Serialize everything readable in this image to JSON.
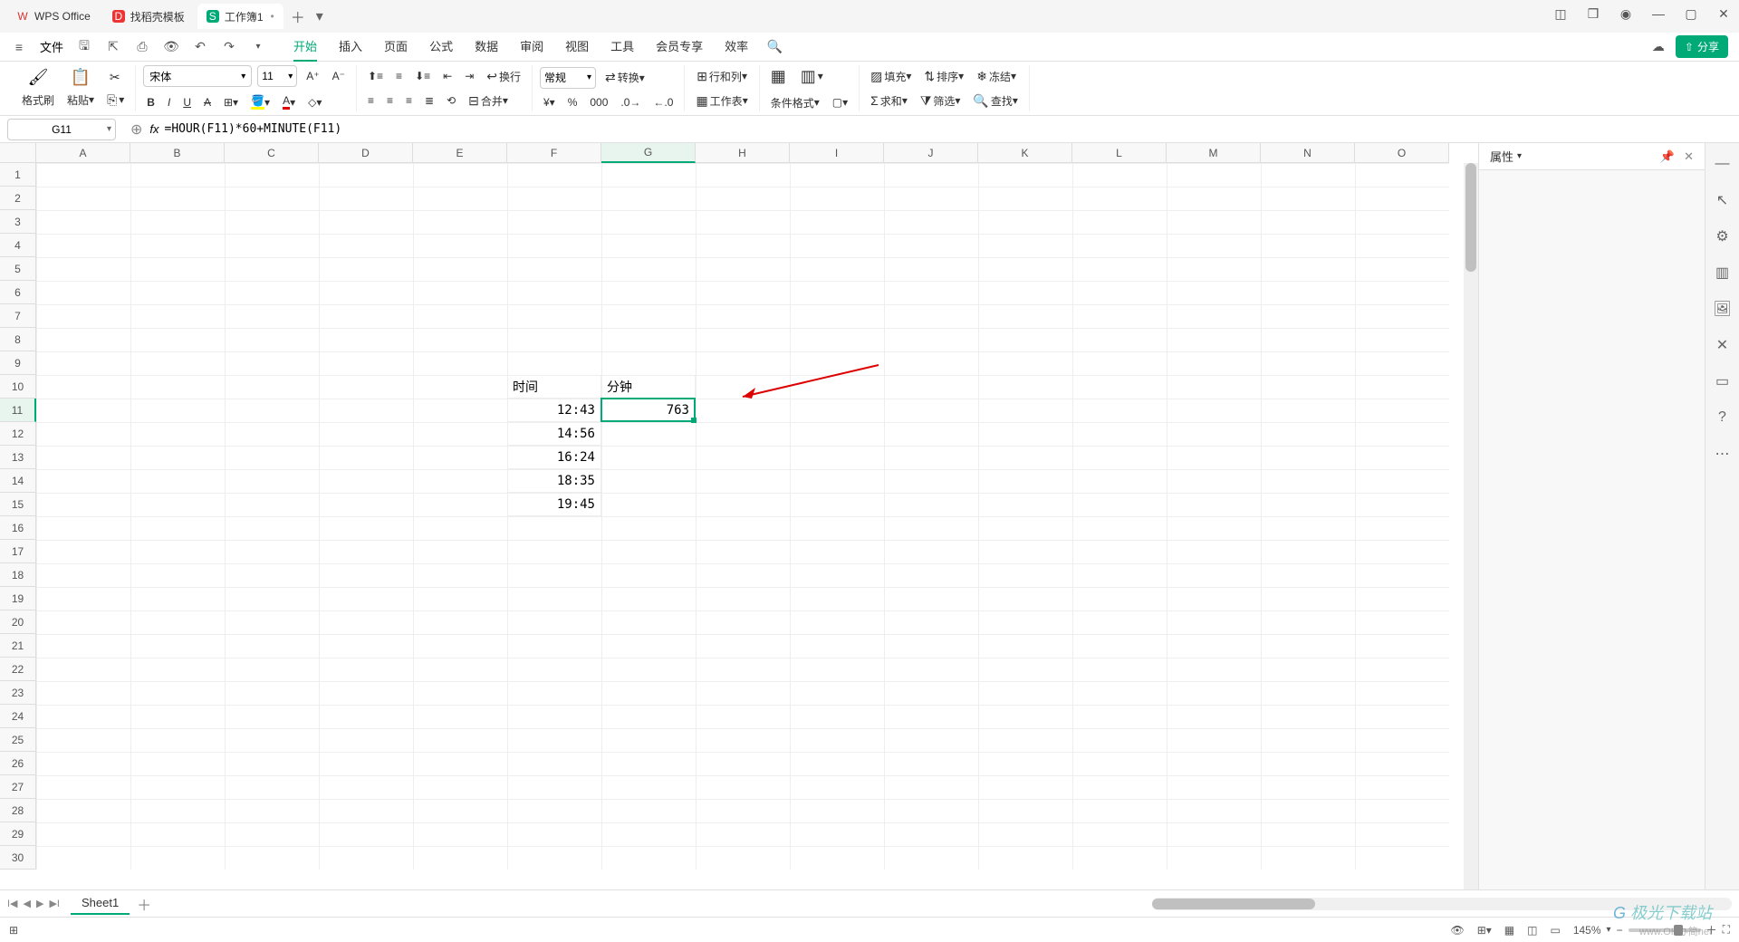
{
  "tabs": {
    "wps": "WPS Office",
    "template": "找稻壳模板",
    "workbook": "工作簿1"
  },
  "file_menu": "文件",
  "menus": [
    "开始",
    "插入",
    "页面",
    "公式",
    "数据",
    "审阅",
    "视图",
    "工具",
    "会员专享",
    "效率"
  ],
  "ribbon": {
    "format_painter": "格式刷",
    "paste": "粘贴",
    "font": "宋体",
    "size": "11",
    "wrap": "换行",
    "merge": "合并",
    "numfmt": "常规",
    "convert": "转换",
    "rowcol": "行和列",
    "worksheet": "工作表",
    "condfmt": "条件格式",
    "fill": "填充",
    "sort": "排序",
    "freeze": "冻结",
    "sum": "求和",
    "filter": "筛选",
    "find": "查找"
  },
  "share": "分享",
  "namebox": "G11",
  "formula": "=HOUR(F11)*60+MINUTE(F11)",
  "cols": [
    "A",
    "B",
    "C",
    "D",
    "E",
    "F",
    "G",
    "H",
    "I",
    "J",
    "K",
    "L",
    "M",
    "N",
    "O"
  ],
  "rowcount": 30,
  "data": {
    "F10": "时间",
    "G10": "分钟",
    "F11": "12:43",
    "G11": "763",
    "F12": "14:56",
    "F13": "16:24",
    "F14": "18:35",
    "F15": "19:45"
  },
  "active": {
    "col": 6,
    "row": 11
  },
  "side": {
    "title": "属性"
  },
  "sheet_tab": "Sheet1",
  "zoom": "145%",
  "watermark": "极光下载站",
  "watermark2": "www.OH办简net"
}
